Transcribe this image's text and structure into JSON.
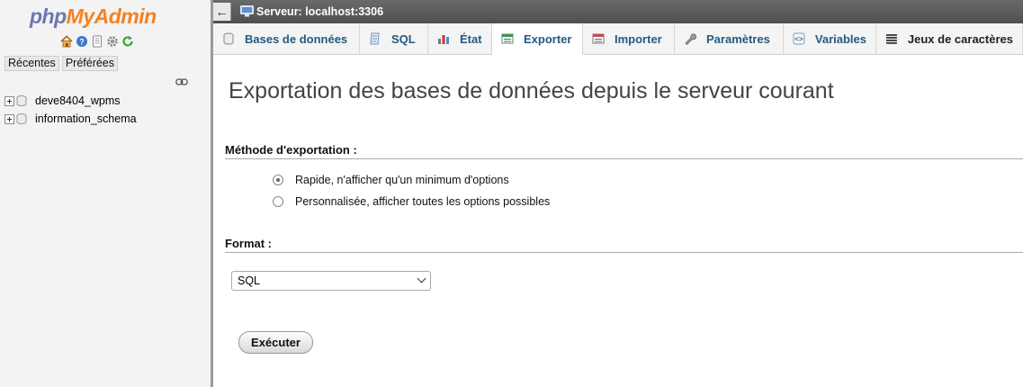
{
  "nav": {
    "logo_php": "php",
    "logo_myadmin": "MyAdmin",
    "icons": [
      "home-icon",
      "help-icon",
      "docs-icon",
      "settings-icon",
      "reload-icon"
    ],
    "tabs": [
      {
        "label": "Récentes"
      },
      {
        "label": "Préférées"
      }
    ],
    "databases": [
      {
        "name": "deve8404_wpms"
      },
      {
        "name": "information_schema"
      }
    ]
  },
  "topbar": {
    "back_glyph": "←",
    "server_label": "Serveur: localhost:3306"
  },
  "tabs": [
    {
      "label": "Bases de données",
      "icon": "database-icon"
    },
    {
      "label": "SQL",
      "icon": "sql-icon"
    },
    {
      "label": "État",
      "icon": "status-icon"
    },
    {
      "label": "Exporter",
      "icon": "export-icon",
      "active": true
    },
    {
      "label": "Importer",
      "icon": "import-icon"
    },
    {
      "label": "Paramètres",
      "icon": "wrench-icon"
    },
    {
      "label": "Variables",
      "icon": "variables-icon"
    },
    {
      "label": "Jeux de caractères",
      "icon": "charset-icon"
    }
  ],
  "main": {
    "title": "Exportation des bases de données depuis le serveur courant",
    "method_label": "Méthode d'exportation :",
    "method_options": [
      {
        "label": "Rapide, n'afficher qu'un minimum d'options",
        "checked": true
      },
      {
        "label": "Personnalisée, afficher toutes les options possibles",
        "checked": false
      }
    ],
    "format_label": "Format :",
    "format_value": "SQL",
    "go_label": "Exécuter"
  },
  "colors": {
    "tab_text": "#235a81",
    "logo_php": "#6c78af",
    "logo_myadmin": "#f58220",
    "topbar": "#5a5a5a"
  }
}
